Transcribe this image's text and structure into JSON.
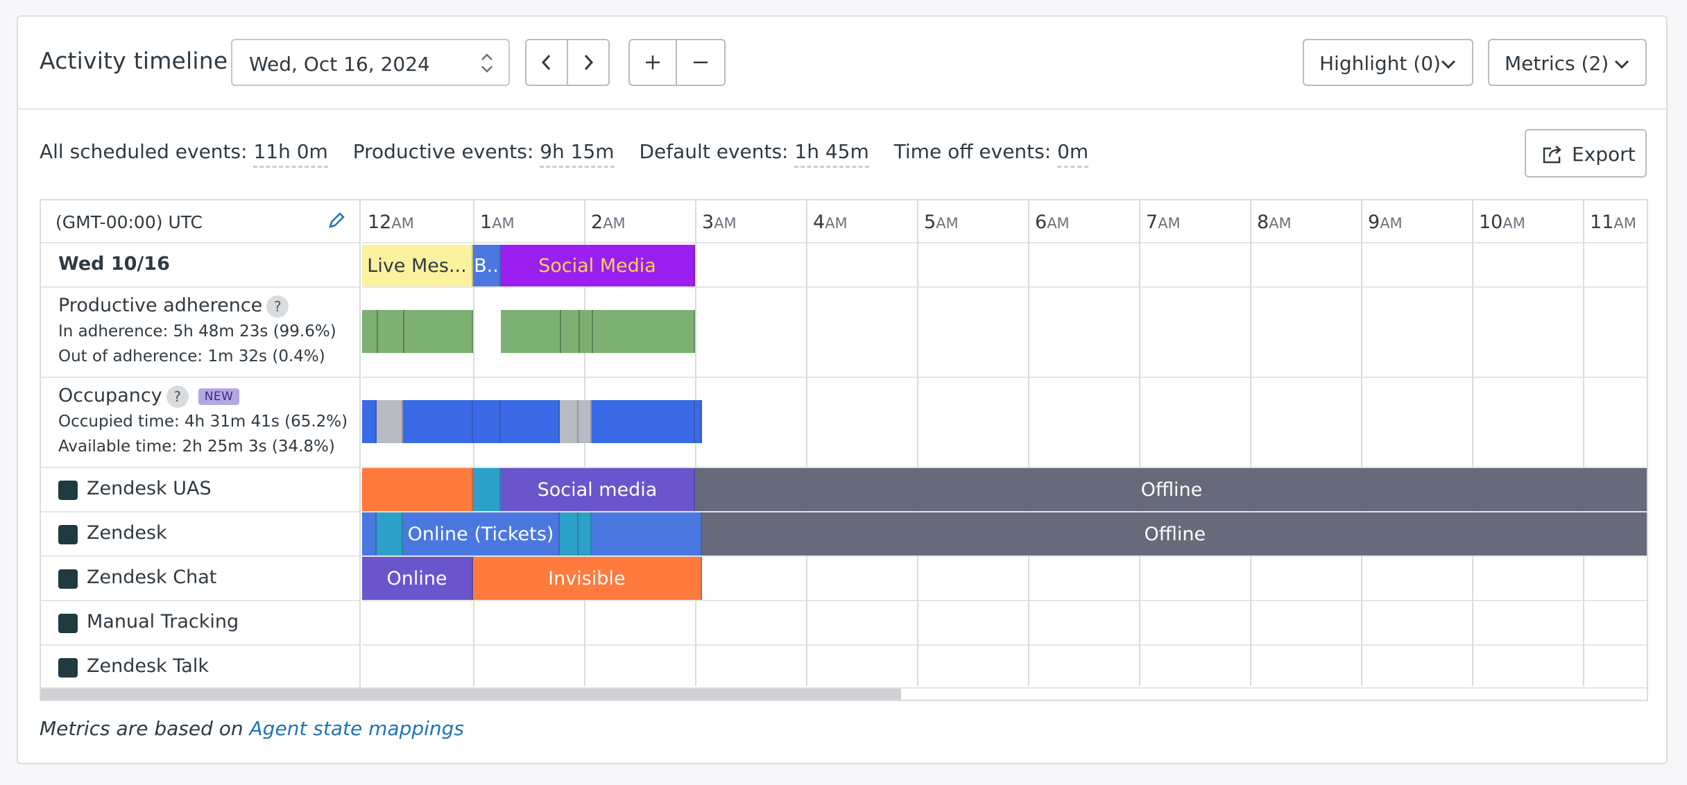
{
  "header": {
    "title": "Activity timeline",
    "date_value": "Wed, Oct 16, 2024",
    "highlight_label": "Highlight (0)",
    "metrics_label": "Metrics (2)"
  },
  "summary": {
    "all_label": "All scheduled events:",
    "all_value": "11h 0m",
    "productive_label": "Productive events:",
    "productive_value": "9h 15m",
    "default_label": "Default events:",
    "default_value": "1h 45m",
    "timeoff_label": "Time off events:",
    "timeoff_value": "0m",
    "export_label": "Export"
  },
  "grid": {
    "timezone": "(GMT-00:00) UTC",
    "hours": [
      {
        "h": "12",
        "p": "AM"
      },
      {
        "h": "1",
        "p": "AM"
      },
      {
        "h": "2",
        "p": "AM"
      },
      {
        "h": "3",
        "p": "AM"
      },
      {
        "h": "4",
        "p": "AM"
      },
      {
        "h": "5",
        "p": "AM"
      },
      {
        "h": "6",
        "p": "AM"
      },
      {
        "h": "7",
        "p": "AM"
      },
      {
        "h": "8",
        "p": "AM"
      },
      {
        "h": "9",
        "p": "AM"
      },
      {
        "h": "10",
        "p": "AM"
      },
      {
        "h": "11",
        "p": "AM"
      }
    ],
    "day_label": "Wed 10/16",
    "productive": {
      "title": "Productive adherence",
      "in_adherence": "In adherence: 5h 48m 23s  (99.6%)",
      "out_adherence": "Out of adherence: 1m 32s  (0.4%)"
    },
    "occupancy": {
      "title": "Occupancy",
      "badge": "NEW",
      "occupied": "Occupied time: 4h 31m 41s  (65.2%)",
      "available": "Available time: 2h 25m 3s  (34.8%)"
    },
    "sources": [
      {
        "name": "Zendesk UAS",
        "icon": "zendesk-icon"
      },
      {
        "name": "Zendesk",
        "icon": "zendesk-icon"
      },
      {
        "name": "Zendesk Chat",
        "icon": "zendesk-chat-icon"
      },
      {
        "name": "Manual Tracking",
        "icon": "zendesk-icon"
      },
      {
        "name": "Zendesk Talk",
        "icon": "zendesk-talk-icon"
      }
    ],
    "segments": {
      "schedule": [
        {
          "start": 0.0,
          "end": 1.0,
          "label": "Live Mes...",
          "bg": "#fbf2a0",
          "fg": "#2f3941"
        },
        {
          "start": 1.0,
          "end": 1.25,
          "label": "B..",
          "bg": "#4a78e0",
          "fg": "#ffffff"
        },
        {
          "start": 1.25,
          "end": 3.0,
          "label": "Social Media",
          "bg": "#9b1ff0",
          "fg": "#f7d25a"
        }
      ],
      "productive": [
        {
          "start": 0.0,
          "end": 1.0,
          "bg": "#7db174"
        },
        {
          "start": 1.25,
          "end": 3.0,
          "bg": "#7db174"
        }
      ],
      "productive_ticks": [
        0.13,
        0.37,
        1.78,
        1.95,
        2.07
      ],
      "occupancy": [
        {
          "start": 0.0,
          "end": 0.13,
          "bg": "#3a6ae6"
        },
        {
          "start": 0.13,
          "end": 0.37,
          "bg": "#b9bbc3"
        },
        {
          "start": 0.37,
          "end": 1.0,
          "bg": "#3a6ae6"
        },
        {
          "start": 1.0,
          "end": 1.25,
          "bg": "#3a6ae6"
        },
        {
          "start": 1.25,
          "end": 1.78,
          "bg": "#3a6ae6"
        },
        {
          "start": 1.78,
          "end": 1.95,
          "bg": "#b9bbc3"
        },
        {
          "start": 1.95,
          "end": 2.07,
          "bg": "#b9bbc3"
        },
        {
          "start": 2.07,
          "end": 3.0,
          "bg": "#3a6ae6"
        },
        {
          "start": 3.0,
          "end": 3.06,
          "bg": "#3a6ae6"
        }
      ],
      "uas": [
        {
          "start": 0.0,
          "end": 1.0,
          "label": "",
          "bg": "#ff7a3d",
          "fg": "#ffffff"
        },
        {
          "start": 1.0,
          "end": 1.25,
          "label": "",
          "bg": "#2ca0c8",
          "fg": "#ffffff"
        },
        {
          "start": 1.25,
          "end": 3.0,
          "label": "Social media",
          "bg": "#6a55cc",
          "fg": "#ffffff"
        },
        {
          "start": 3.0,
          "end": 11.6,
          "label": "Offline",
          "bg": "#676a7b",
          "fg": "#ffffff"
        }
      ],
      "zendesk": [
        {
          "start": 0.0,
          "end": 0.13,
          "label": "",
          "bg": "#4a78e0",
          "fg": "#ffffff"
        },
        {
          "start": 0.13,
          "end": 0.37,
          "label": "",
          "bg": "#2ca0c8",
          "fg": "#ffffff"
        },
        {
          "start": 0.37,
          "end": 1.78,
          "label": "Online (Tickets)",
          "bg": "#4a78e0",
          "fg": "#ffffff"
        },
        {
          "start": 1.78,
          "end": 1.95,
          "label": "",
          "bg": "#2ca0c8",
          "fg": "#ffffff"
        },
        {
          "start": 1.95,
          "end": 2.07,
          "label": "",
          "bg": "#2ca0c8",
          "fg": "#ffffff"
        },
        {
          "start": 2.07,
          "end": 3.06,
          "label": "",
          "bg": "#4a78e0",
          "fg": "#ffffff"
        },
        {
          "start": 3.06,
          "end": 11.6,
          "label": "Offline",
          "bg": "#676a7b",
          "fg": "#ffffff"
        }
      ],
      "chat": [
        {
          "start": 0.0,
          "end": 1.0,
          "label": "Online",
          "bg": "#6a55cc",
          "fg": "#ffffff"
        },
        {
          "start": 1.0,
          "end": 3.06,
          "label": "Invisible",
          "bg": "#ff7a3d",
          "fg": "#ffffff"
        }
      ]
    }
  },
  "footer": {
    "prefix": "Metrics are based on ",
    "link": "Agent state mappings"
  }
}
